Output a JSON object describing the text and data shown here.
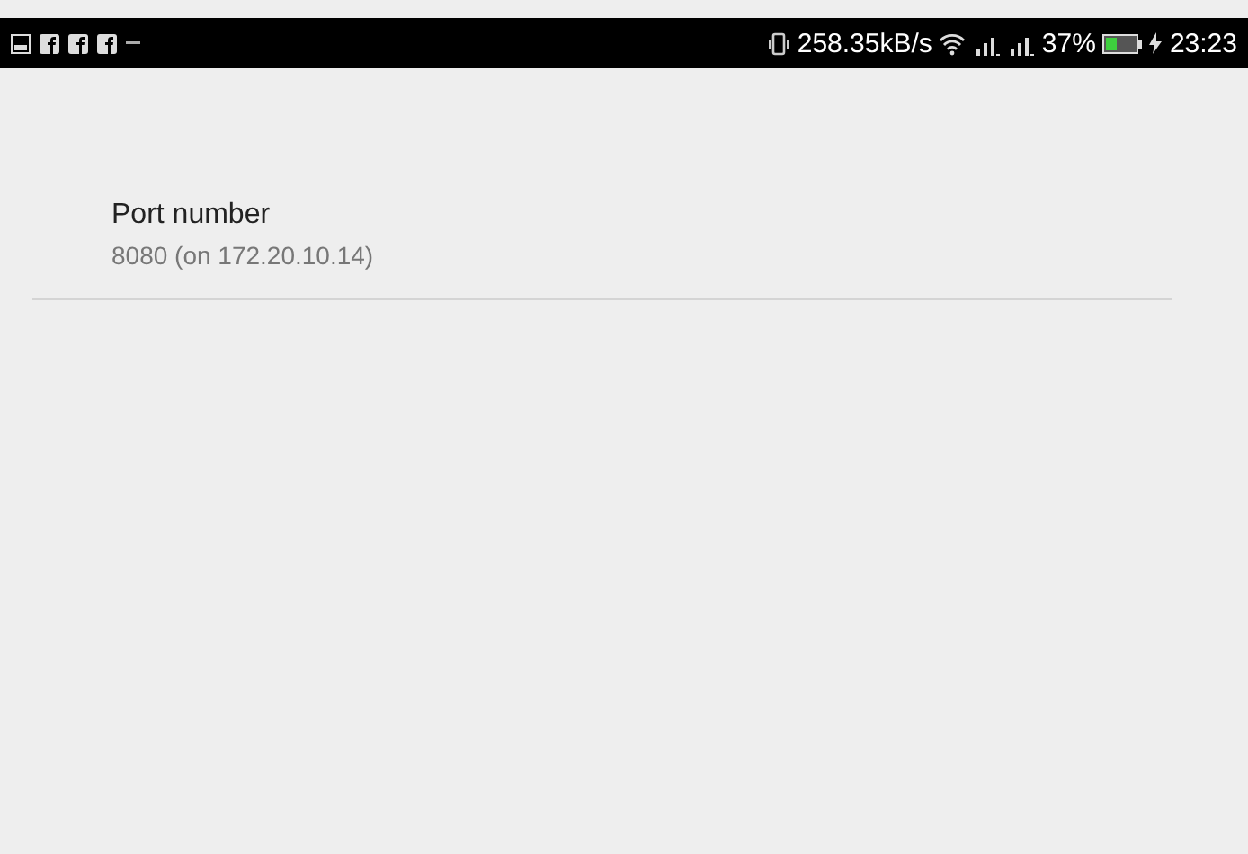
{
  "status_bar": {
    "network_speed": "258.35kB/s",
    "battery_percent": "37%",
    "time": "23:23"
  },
  "preferences": [
    {
      "title": "Port number",
      "summary": "8080 (on 172.20.10.14)"
    }
  ]
}
